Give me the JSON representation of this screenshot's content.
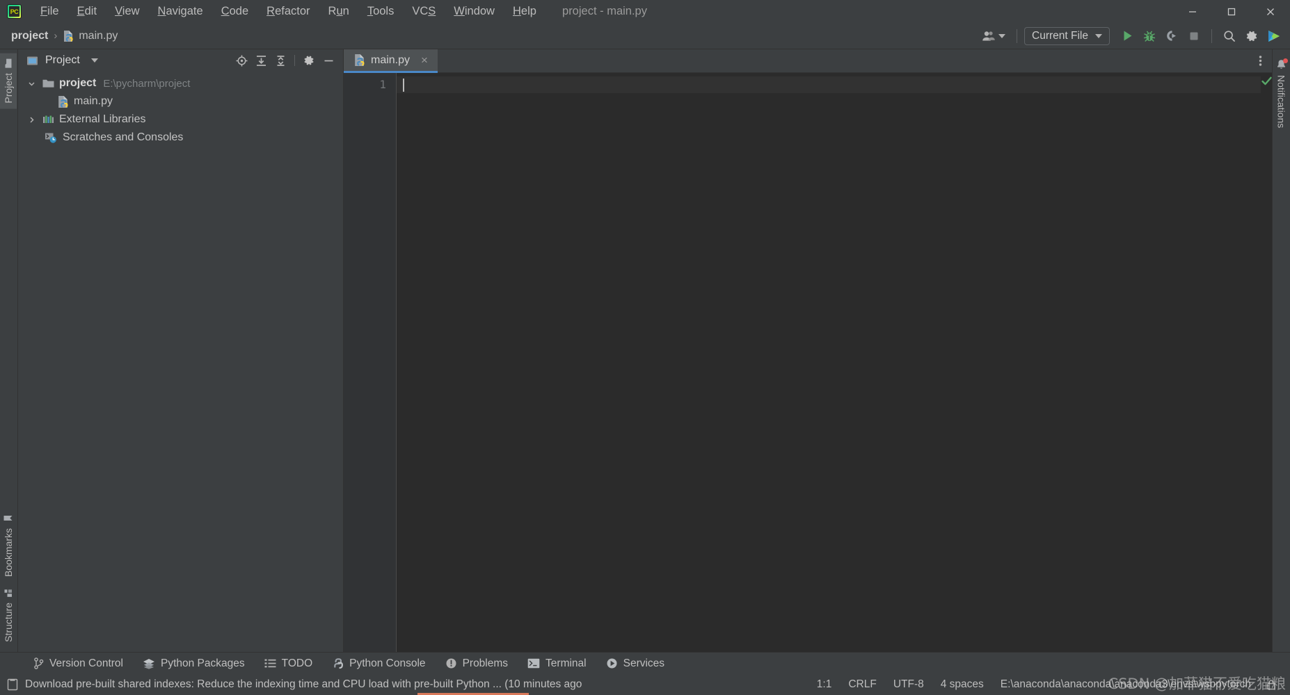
{
  "window": {
    "title": "project - main.py",
    "app_icon": "pycharm-logo-icon",
    "controls": {
      "minimize": "minimize-icon",
      "maximize": "maximize-icon",
      "close": "close-icon"
    }
  },
  "menubar": {
    "items": [
      {
        "label": "File",
        "mnemonic": "F"
      },
      {
        "label": "Edit",
        "mnemonic": "E"
      },
      {
        "label": "View",
        "mnemonic": "V"
      },
      {
        "label": "Navigate",
        "mnemonic": "N"
      },
      {
        "label": "Code",
        "mnemonic": "C"
      },
      {
        "label": "Refactor",
        "mnemonic": "R"
      },
      {
        "label": "Run",
        "mnemonic": "u"
      },
      {
        "label": "Tools",
        "mnemonic": "T"
      },
      {
        "label": "VCS",
        "mnemonic": "S"
      },
      {
        "label": "Window",
        "mnemonic": "W"
      },
      {
        "label": "Help",
        "mnemonic": "H"
      }
    ]
  },
  "toolbar": {
    "breadcrumb": {
      "project": "project",
      "separator": "›",
      "file": "main.py",
      "file_icon": "python-file-icon"
    },
    "people_icon": "people-icon",
    "run_config": {
      "label": "Current File",
      "caret": "chevron-down-icon"
    },
    "actions": [
      {
        "name": "run-button",
        "icon": "play-icon",
        "color": "#59a869"
      },
      {
        "name": "debug-button",
        "icon": "bug-icon",
        "color": "#59a869"
      },
      {
        "name": "run-with-coverage-button",
        "icon": "coverage-icon",
        "color": "#9aa0a6"
      },
      {
        "name": "stop-button",
        "icon": "stop-square-icon",
        "color": "#808080"
      },
      {
        "name": "search-everywhere-button",
        "icon": "search-icon",
        "color": "#b3b3b3"
      },
      {
        "name": "settings-button",
        "icon": "gear-icon",
        "color": "#c0c0c0"
      },
      {
        "name": "ide-services-button",
        "icon": "colorful-play-icon",
        "color": "#4aa3df"
      }
    ]
  },
  "left_stripe": {
    "top_tabs": [
      {
        "label": "Project",
        "icon": "folder-icon",
        "active": true
      }
    ],
    "bottom_tabs": [
      {
        "label": "Bookmarks",
        "icon": "bookmark-icon"
      },
      {
        "label": "Structure",
        "icon": "structure-icon"
      }
    ]
  },
  "project_panel": {
    "title": "Project",
    "title_icon": "project-window-icon",
    "title_caret": "chevron-down-icon",
    "tools": [
      {
        "name": "select-opened-file-button",
        "icon": "crosshair-target-icon"
      },
      {
        "name": "expand-all-button",
        "icon": "expand-all-icon"
      },
      {
        "name": "collapse-all-button",
        "icon": "collapse-all-icon"
      },
      {
        "name": "panel-settings-button",
        "icon": "gear-icon"
      },
      {
        "name": "hide-panel-button",
        "icon": "minus-icon"
      }
    ],
    "tree": [
      {
        "label": "project",
        "path": "E:\\pycharm\\project",
        "icon": "folder-icon",
        "twisty": "chevron-down-icon",
        "expanded": true,
        "indent": 0,
        "bold": true
      },
      {
        "label": "main.py",
        "path": "",
        "icon": "python-file-icon",
        "twisty": "",
        "expanded": false,
        "indent": 1,
        "bold": false
      },
      {
        "label": "External Libraries",
        "path": "",
        "icon": "libraries-bars-icon",
        "twisty": "chevron-right-icon",
        "expanded": false,
        "indent": 0,
        "bold": false
      },
      {
        "label": "Scratches and Consoles",
        "path": "",
        "icon": "scratches-console-icon",
        "twisty": "",
        "expanded": false,
        "indent": 0,
        "bold": false
      }
    ]
  },
  "editor": {
    "tabs": [
      {
        "label": "main.py",
        "icon": "python-file-icon",
        "close": "×",
        "active": true
      }
    ],
    "tab_more_icon": "more-vertical-icon",
    "line_numbers": [
      "1"
    ],
    "content_lines": [
      ""
    ],
    "inspection_status": "no-problems-checkmark-icon"
  },
  "right_stripe": {
    "tabs": [
      {
        "label": "Notifications",
        "icon": "bell-icon",
        "has_badge": true
      }
    ]
  },
  "bottom_tool_windows": [
    {
      "label": "Version Control",
      "icon": "branch-icon"
    },
    {
      "label": "Python Packages",
      "icon": "layers-icon"
    },
    {
      "label": "TODO",
      "icon": "list-icon"
    },
    {
      "label": "Python Console",
      "icon": "python-icon"
    },
    {
      "label": "Problems",
      "icon": "warning-circle-icon"
    },
    {
      "label": "Terminal",
      "icon": "terminal-icon"
    },
    {
      "label": "Services",
      "icon": "play-circle-icon"
    }
  ],
  "statusbar": {
    "message_icon": "notification-document-icon",
    "message": "Download pre-built shared indexes: Reduce the indexing time and CPU load with pre-built Python ... (10 minutes ago",
    "caret_position": "1:1",
    "line_separator": "CRLF",
    "encoding": "UTF-8",
    "indent": "4 spaces",
    "interpreter": "E:\\anaconda\\anaconda\\anaconda3\\envs\\wsbpytorch",
    "lock_icon": "lock-icon"
  },
  "watermark": "CSDN @加菲猫不爱吃猫粮",
  "colors": {
    "background": "#3c3f41",
    "editor_background": "#2b2b2b",
    "gutter_background": "#313335",
    "accent_blue": "#4a88c7",
    "run_green": "#59a869",
    "text": "#bbbbbb"
  }
}
